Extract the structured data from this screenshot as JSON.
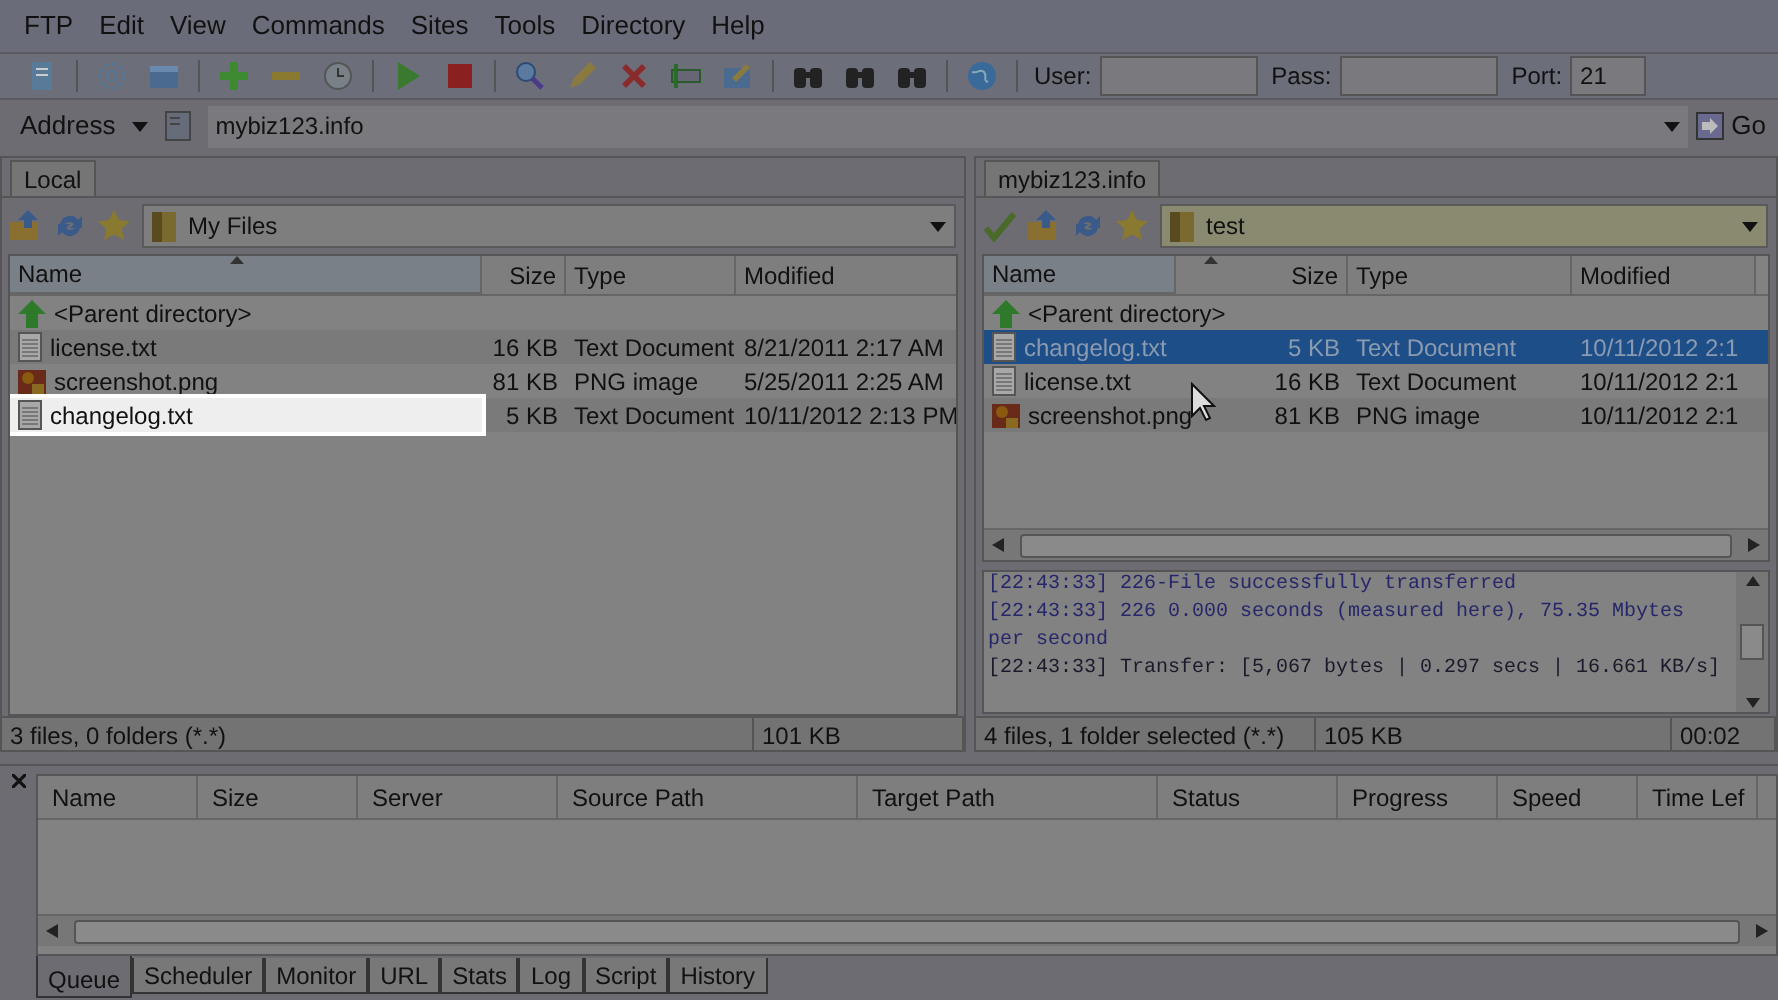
{
  "menu": [
    "FTP",
    "Edit",
    "View",
    "Commands",
    "Sites",
    "Tools",
    "Directory",
    "Help"
  ],
  "connection": {
    "user_label": "User:",
    "pass_label": "Pass:",
    "port_label": "Port:",
    "port": "21"
  },
  "address": {
    "label": "Address",
    "value": "mybiz123.info",
    "go": "Go"
  },
  "local": {
    "tab": "Local",
    "path": "My Files",
    "columns": [
      "Name",
      "Size",
      "Type",
      "Modified"
    ],
    "rows": [
      {
        "kind": "parent",
        "name": "<Parent directory>",
        "selected": false,
        "highlighted": false
      },
      {
        "kind": "text",
        "name": "license.txt",
        "size": "16 KB",
        "type": "Text Document",
        "modified": "8/21/2011 2:17 AM",
        "selected": false,
        "highlighted": false
      },
      {
        "kind": "image",
        "name": "screenshot.png",
        "size": "81 KB",
        "type": "PNG image",
        "modified": "5/25/2011 2:25 AM",
        "selected": false,
        "highlighted": false
      },
      {
        "kind": "text",
        "name": "changelog.txt",
        "size": "5 KB",
        "type": "Text Document",
        "modified": "10/11/2012 2:13 PM",
        "selected": false,
        "highlighted": true
      }
    ],
    "status": [
      "3 files, 0 folders (*.*)",
      "101 KB"
    ]
  },
  "remote": {
    "tab": "mybiz123.info",
    "path": "test",
    "columns": [
      "Name",
      "Size",
      "Type",
      "Modified"
    ],
    "rows": [
      {
        "kind": "parent",
        "name": "<Parent directory>",
        "selected": false,
        "highlighted": false
      },
      {
        "kind": "text",
        "name": "changelog.txt",
        "size": "5 KB",
        "type": "Text Document",
        "modified": "10/11/2012 2:1",
        "selected": true,
        "highlighted": false
      },
      {
        "kind": "text",
        "name": "license.txt",
        "size": "16 KB",
        "type": "Text Document",
        "modified": "10/11/2012 2:1",
        "selected": false,
        "highlighted": false
      },
      {
        "kind": "image",
        "name": "screenshot.png",
        "size": "81 KB",
        "type": "PNG image",
        "modified": "10/11/2012 2:1",
        "selected": false,
        "highlighted": false
      }
    ],
    "log": [
      "[22:43:33] 226-File successfully transferred",
      "[22:43:33] 226 0.000 seconds (measured here), 75.35 Mbytes per second",
      "[22:43:33] Transfer: [5,067 bytes | 0.297 secs | 16.661 KB/s]"
    ],
    "status": [
      "4 files, 1 folder selected (*.*)",
      "105 KB",
      "00:02"
    ]
  },
  "queue": {
    "columns": [
      "Name",
      "Size",
      "Server",
      "Source Path",
      "Target Path",
      "Status",
      "Progress",
      "Speed",
      "Time Lef"
    ],
    "tabs": [
      {
        "label": "Queue",
        "selected": true
      },
      {
        "label": "Scheduler",
        "selected": false
      },
      {
        "label": "Monitor",
        "selected": false
      },
      {
        "label": "URL",
        "selected": false
      },
      {
        "label": "Stats",
        "selected": false
      },
      {
        "label": "Log",
        "selected": false
      },
      {
        "label": "Script",
        "selected": false
      },
      {
        "label": "History",
        "selected": false
      }
    ]
  }
}
